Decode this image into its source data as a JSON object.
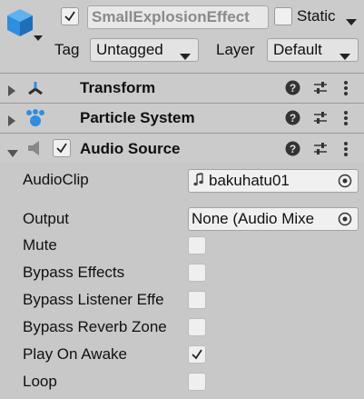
{
  "header": {
    "object_name": "SmallExplosionEffect",
    "active_checked": true,
    "static_label": "Static",
    "static_checked": false,
    "tag_label": "Tag",
    "tag_value": "Untagged",
    "layer_label": "Layer",
    "layer_value": "Default"
  },
  "components": [
    {
      "title": "Transform",
      "icon": "transform-icon",
      "expanded": false
    },
    {
      "title": "Particle System",
      "icon": "particle-system-icon",
      "expanded": false
    },
    {
      "title": "Audio Source",
      "icon": "audio-source-icon",
      "expanded": true,
      "enabled": true
    }
  ],
  "audio_source": {
    "audioclip_label": "AudioClip",
    "audioclip_value": "bakuhatu01",
    "audioclip_icon": "music-note-icon",
    "output_label": "Output",
    "output_value": "None (Audio Mixe",
    "mute_label": "Mute",
    "mute_checked": false,
    "bypass_effects_label": "Bypass Effects",
    "bypass_effects_checked": false,
    "bypass_listener_label": "Bypass Listener Effe",
    "bypass_listener_checked": false,
    "bypass_reverb_label": "Bypass Reverb Zone",
    "bypass_reverb_checked": false,
    "play_on_awake_label": "Play On Awake",
    "play_on_awake_checked": true,
    "loop_label": "Loop",
    "loop_checked": false
  },
  "colors": {
    "cube_icon": "#2f8ee0",
    "particle_icon": "#2f8ee0",
    "panel_bg": "#c8c8c8"
  }
}
